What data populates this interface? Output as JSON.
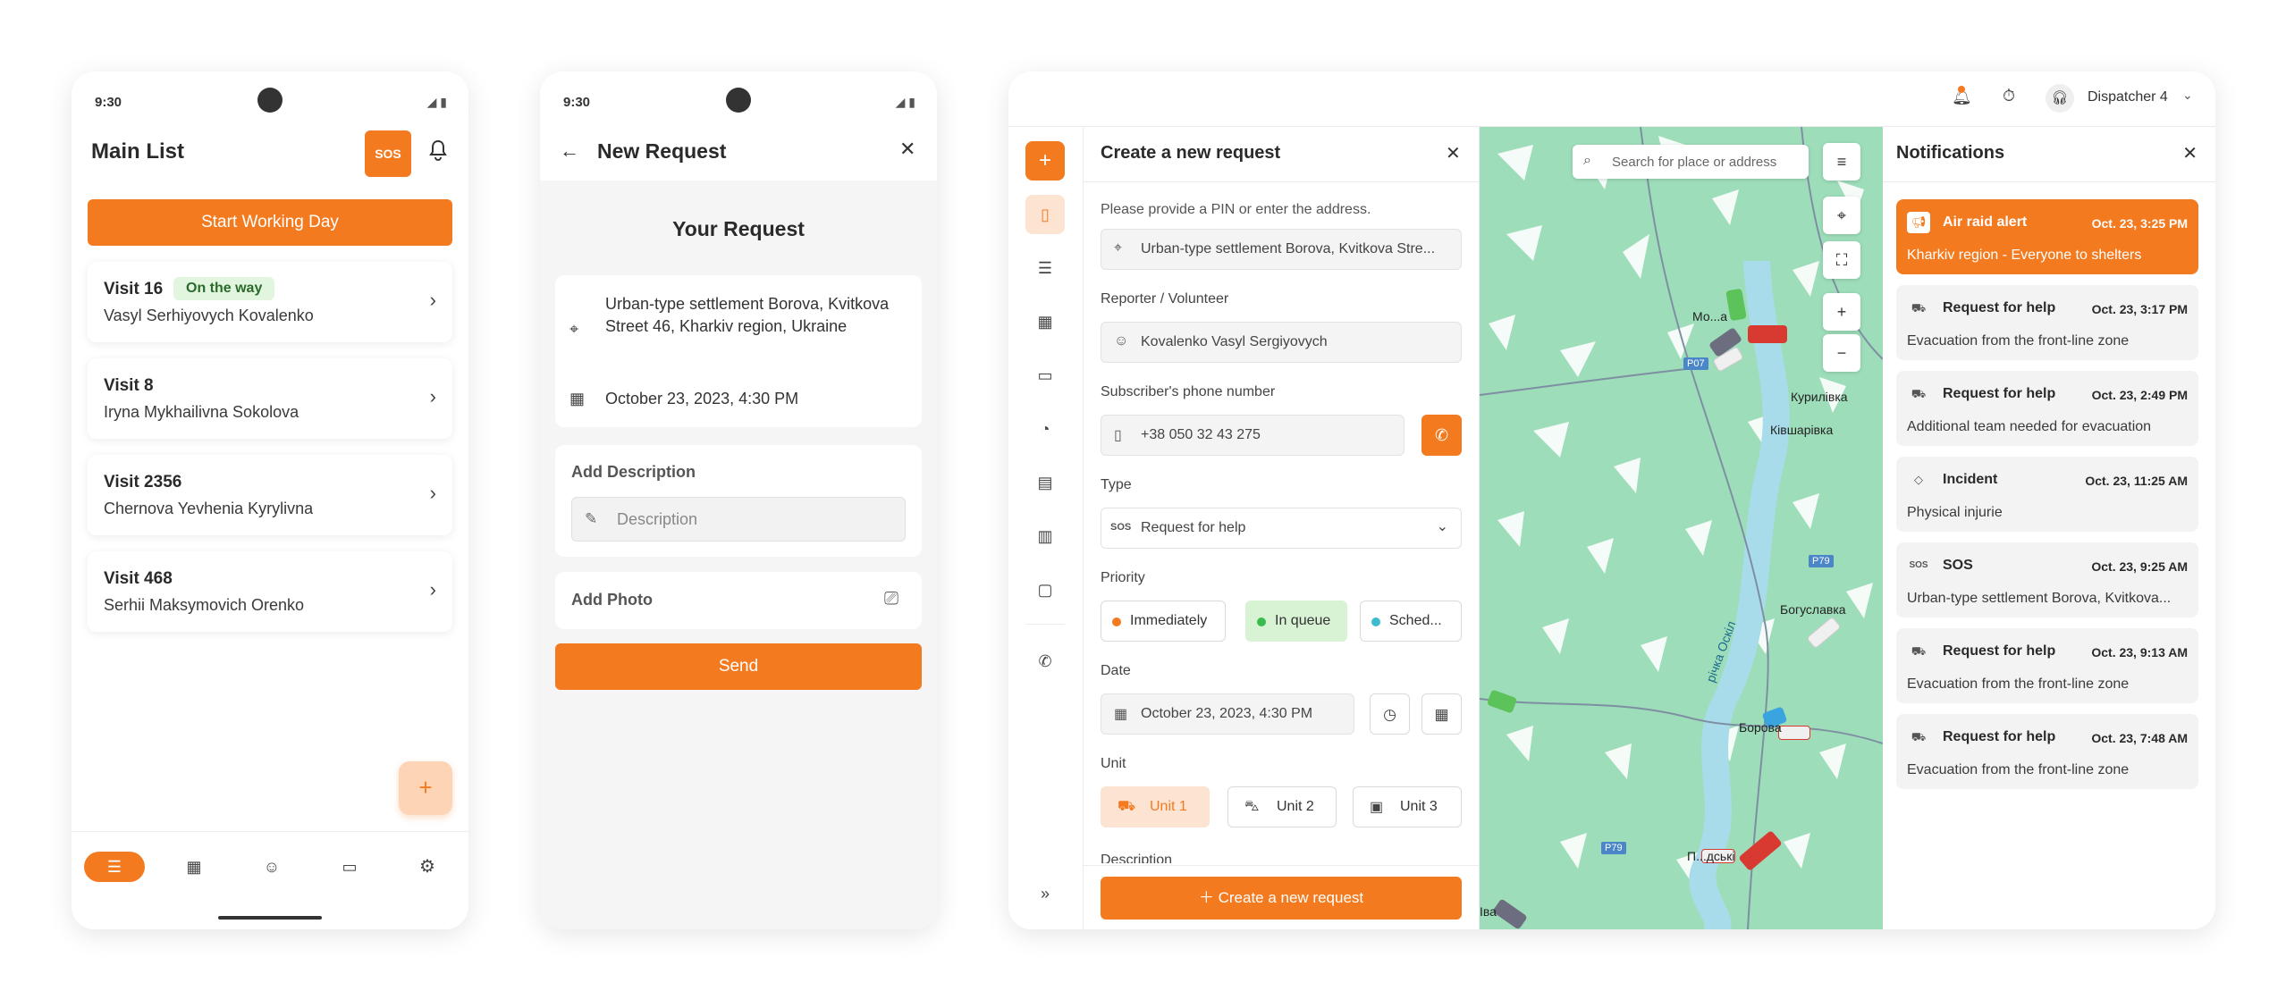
{
  "phone1": {
    "time": "9:30",
    "title": "Main List",
    "sos_label": "SOS",
    "start_button": "Start Working Day",
    "visits": [
      {
        "title": "Visit 16",
        "badge": "On the way",
        "name": "Vasyl Serhiyovych Kovalenko"
      },
      {
        "title": "Visit 8",
        "badge": "",
        "name": "Iryna Mykhailivna Sokolova"
      },
      {
        "title": "Visit 2356",
        "badge": "",
        "name": "Chernova Yevhenia Kyrylivna"
      },
      {
        "title": "Visit 468",
        "badge": "",
        "name": "Serhii Maksymovich Orenko"
      }
    ],
    "fab": "+",
    "nav_icons": [
      "list-icon",
      "calendar-icon",
      "team-icon",
      "chat-icon",
      "settings-icon"
    ]
  },
  "phone2": {
    "time": "9:30",
    "title": "New Request",
    "heading": "Your Request",
    "address": "Urban-type settlement Borova, Kvitkova Street 46, Kharkiv region, Ukraine",
    "datetime": "October 23, 2023, 4:30 PM",
    "desc_label": "Add Description",
    "desc_placeholder": "Description",
    "photo_label": "Add Photo",
    "send": "Send"
  },
  "desktop": {
    "dispatcher": "Dispatcher 4",
    "form": {
      "title": "Create a new request",
      "hint": "Please provide a PIN or enter the address.",
      "address_value": "Urban-type settlement Borova, Kvitkova Stre...",
      "reporter_label": "Reporter / Volunteer",
      "reporter_value": "Kovalenko Vasyl Sergiyovych",
      "phone_label": "Subscriber's phone number",
      "phone_value": "+38 050 32 43 275",
      "type_label": "Type",
      "type_icon_text": "SOS",
      "type_value": "Request for help",
      "priority_label": "Priority",
      "priority": [
        "Immediately",
        "In queue",
        "Sched..."
      ],
      "date_label": "Date",
      "date_value": "October 23, 2023, 4:30 PM",
      "unit_label": "Unit",
      "units": [
        "Unit 1",
        "Unit 2",
        "Unit 3"
      ],
      "description_label": "Description",
      "create_button": "Create a new request"
    },
    "map": {
      "search_placeholder": "Search for place or address",
      "places": [
        "Мо...а",
        "Курилівка",
        "Ківшарівка",
        "Богуславка",
        "Борова",
        "П...дські",
        "річка Оскіл",
        "Іва"
      ],
      "roads": [
        "P07",
        "P79",
        "P79"
      ],
      "zoom_in": "+",
      "zoom_out": "−"
    },
    "notifications": {
      "title": "Notifications",
      "items": [
        {
          "icon": "megaphone-icon",
          "title": "Air raid alert",
          "date": "Oct. 23, 3:25 PM",
          "body": "Kharkiv region - Everyone to shelters",
          "highlight": true
        },
        {
          "icon": "truck-icon",
          "title": "Request for help",
          "date": "Oct. 23, 3:17 PM",
          "body": "Evacuation from the front-line zone",
          "highlight": false
        },
        {
          "icon": "truck-icon",
          "title": "Request for help",
          "date": "Oct. 23, 2:49 PM",
          "body": "Additional team needed for evacuation",
          "highlight": false
        },
        {
          "icon": "diamond-icon",
          "title": "Incident",
          "date": "Oct. 23, 11:25 AM",
          "body": "Physical injurie",
          "highlight": false
        },
        {
          "icon": "sos-icon",
          "icon_text": "SOS",
          "title": "SOS",
          "date": "Oct. 23, 9:25 AM",
          "body": "Urban-type settlement Borova, Kvitkova...",
          "highlight": false
        },
        {
          "icon": "truck-icon",
          "title": "Request for help",
          "date": "Oct. 23, 9:13 AM",
          "body": "Evacuation from the front-line zone",
          "highlight": false
        },
        {
          "icon": "truck-icon",
          "title": "Request for help",
          "date": "Oct. 23, 7:48 AM",
          "body": "Evacuation from the front-line zone",
          "highlight": false
        }
      ]
    },
    "colors": {
      "accent": "#F47A1F",
      "map_green": "#9DDDB9",
      "river": "#A9DCEA",
      "in_queue_bg": "#D8F2D4"
    }
  }
}
